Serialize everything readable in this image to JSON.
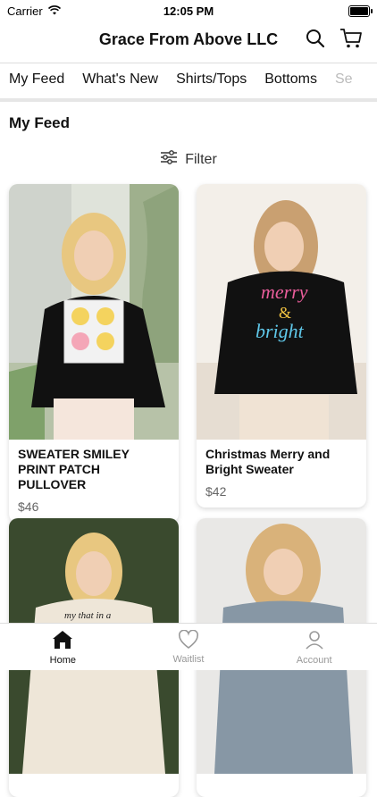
{
  "status": {
    "carrier": "Carrier",
    "time": "12:05 PM"
  },
  "header": {
    "title": "Grace From Above LLC"
  },
  "tabs": [
    {
      "label": "My Feed"
    },
    {
      "label": "What's New"
    },
    {
      "label": "Shirts/Tops"
    },
    {
      "label": "Bottoms"
    },
    {
      "label": "Se"
    }
  ],
  "section": {
    "title": "My Feed"
  },
  "filter": {
    "label": "Filter"
  },
  "products": [
    {
      "name": "SWEATER SMILEY PRINT PATCH PULLOVER",
      "price": "$46"
    },
    {
      "name": "Christmas Merry and Bright Sweater",
      "price": "$42"
    },
    {
      "name": "",
      "price": ""
    },
    {
      "name": "",
      "price": ""
    }
  ],
  "nav": [
    {
      "label": "Home"
    },
    {
      "label": "Waitlist"
    },
    {
      "label": "Account"
    }
  ]
}
